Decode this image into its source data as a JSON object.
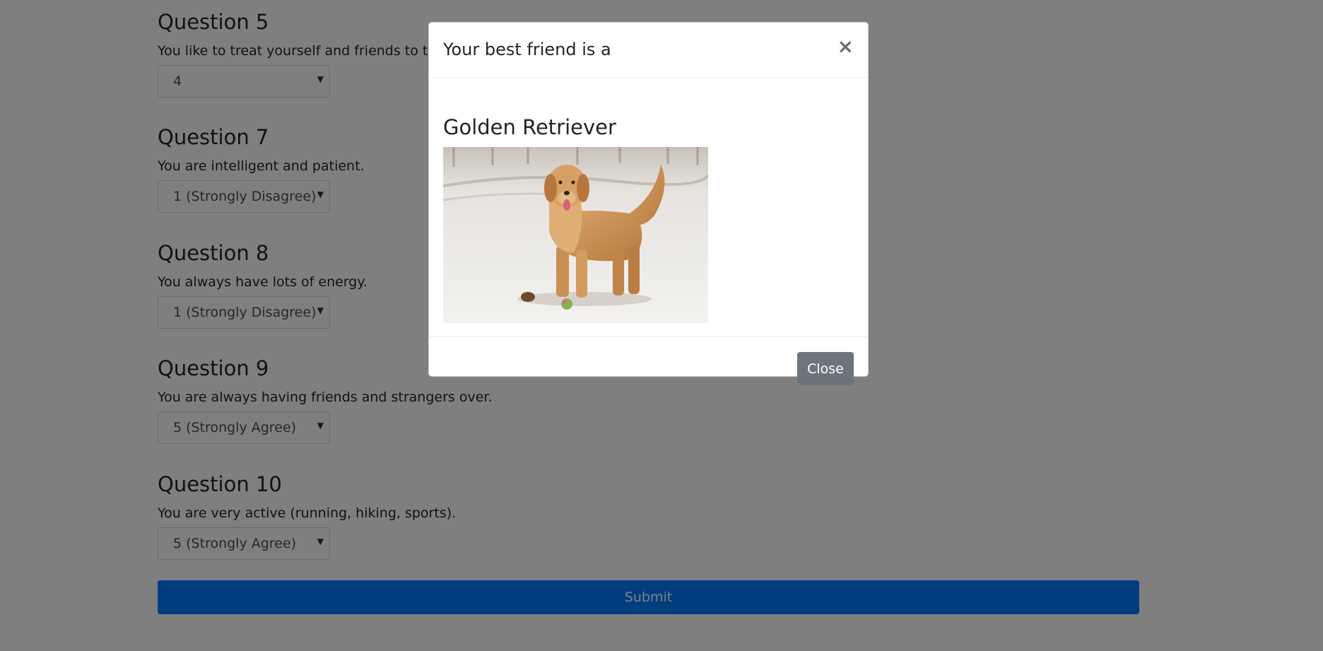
{
  "questions": [
    {
      "title": "Question 5",
      "text": "You like to treat yourself and friends to the",
      "selected": "4"
    },
    {
      "title": "Question 7",
      "text": "You are intelligent and patient.",
      "selected": "1 (Strongly Disagree)"
    },
    {
      "title": "Question 8",
      "text": "You always have lots of energy.",
      "selected": "1 (Strongly Disagree)"
    },
    {
      "title": "Question 9",
      "text": "You are always having friends and strangers over.",
      "selected": "5 (Strongly Agree)"
    },
    {
      "title": "Question 10",
      "text": "You are very active (running, hiking, sports).",
      "selected": "5 (Strongly Agree)"
    }
  ],
  "submit_label": "Submit",
  "modal": {
    "title": "Your best friend is a",
    "close_symbol": "×",
    "breed": "Golden Retriever",
    "close_label": "Close"
  },
  "icons": {
    "dropdown": "caret-down-icon",
    "dismiss": "close-icon"
  },
  "colors": {
    "primary": "#007bff",
    "secondary": "#6c757d",
    "backdrop": "rgba(0,0,0,0.5)"
  }
}
